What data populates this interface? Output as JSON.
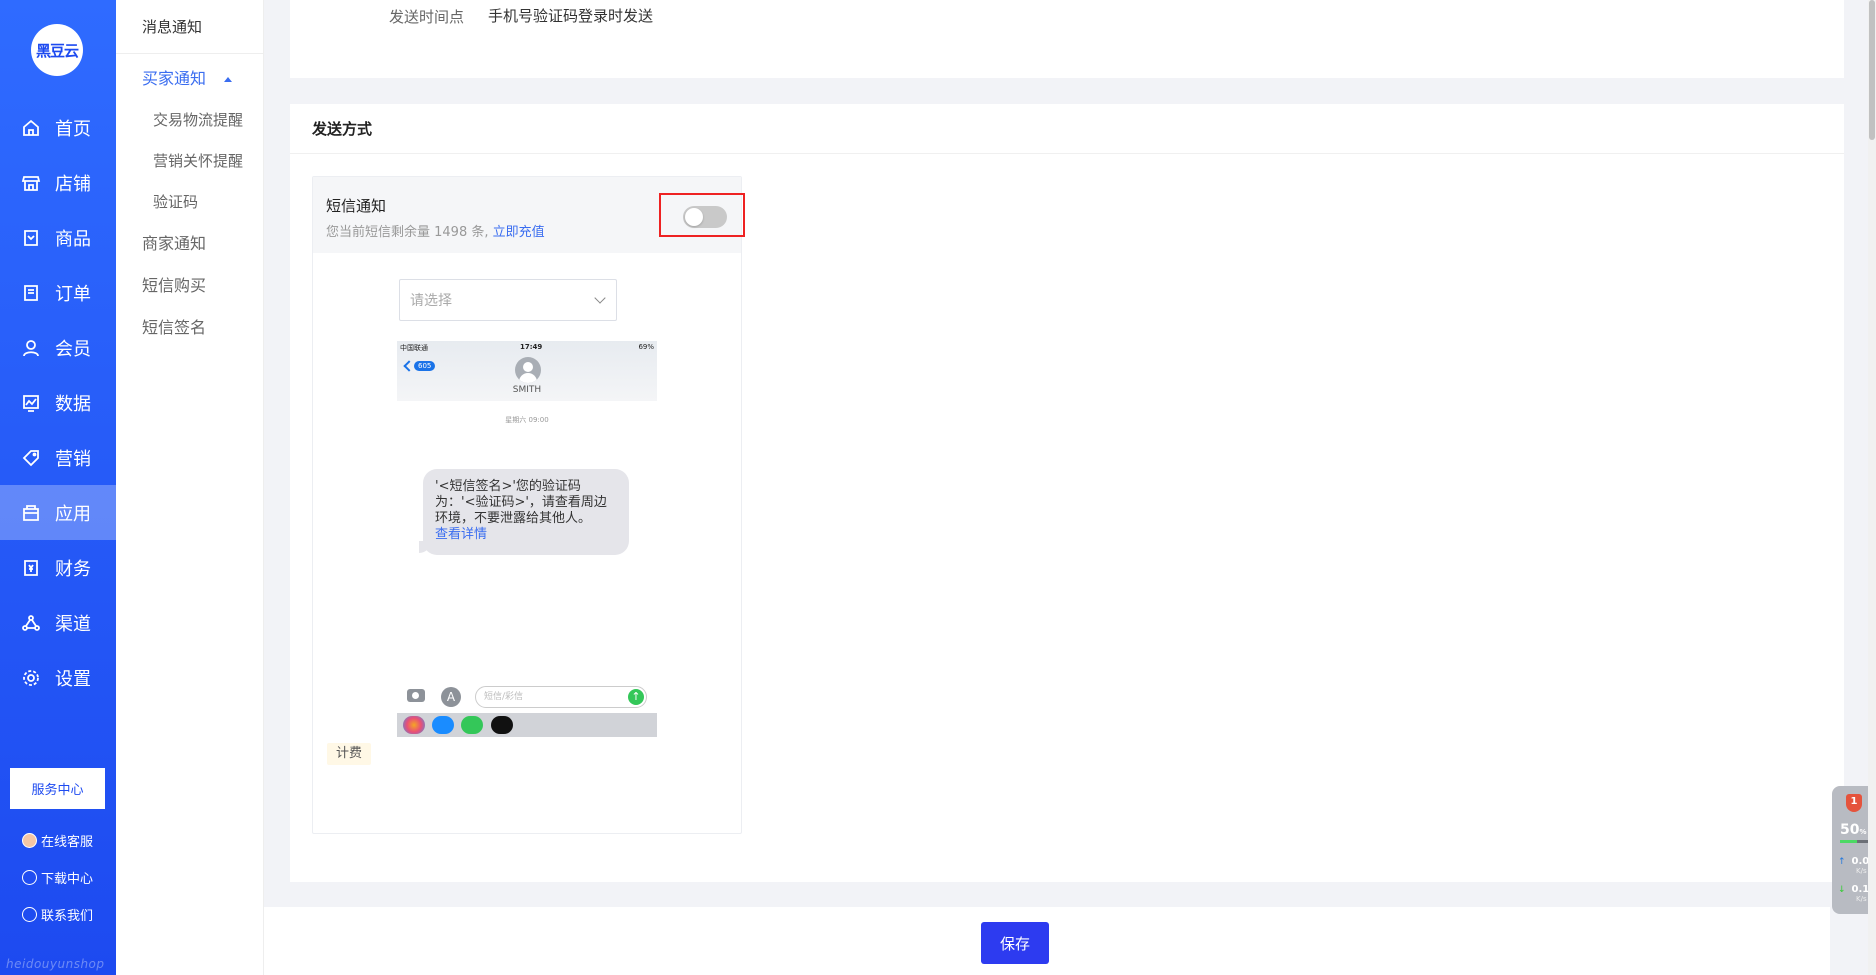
{
  "brand": {
    "logo_text": "黑豆云",
    "watermark": "heidouyunshop"
  },
  "sidebar": {
    "items": [
      {
        "label": "首页",
        "icon": "home-icon"
      },
      {
        "label": "店铺",
        "icon": "shop-icon"
      },
      {
        "label": "商品",
        "icon": "goods-icon"
      },
      {
        "label": "订单",
        "icon": "order-icon"
      },
      {
        "label": "会员",
        "icon": "member-icon"
      },
      {
        "label": "数据",
        "icon": "chart-icon"
      },
      {
        "label": "营销",
        "icon": "tag-icon"
      },
      {
        "label": "应用",
        "icon": "app-icon",
        "active": true
      },
      {
        "label": "财务",
        "icon": "finance-icon"
      },
      {
        "label": "渠道",
        "icon": "channel-icon"
      },
      {
        "label": "设置",
        "icon": "settings-icon"
      }
    ],
    "service_center": "服务中心",
    "online_service": "在线客服",
    "download_center": "下载中心",
    "contact_us": "联系我们"
  },
  "subnav": {
    "header": "消息通知",
    "buyer_notice": "买家通知",
    "buyer_children": [
      "交易物流提醒",
      "营销关怀提醒",
      "验证码"
    ],
    "merchant_notice": "商家通知",
    "sms_purchase": "短信购买",
    "sms_signature": "短信签名"
  },
  "top_card": {
    "send_time_label": "发送时间点",
    "send_time_value": "手机号验证码登录时发送"
  },
  "send_method": {
    "title": "发送方式",
    "sms": {
      "title": "短信通知",
      "desc_prefix": "您当前短信剩余量 1498 条,",
      "recharge_link": "立即充值",
      "enabled": false,
      "select_placeholder": "请选择",
      "fee_tag": "计费"
    }
  },
  "phone": {
    "carrier": "中国联通",
    "time": "17:49",
    "battery": "69%",
    "back_count": "605",
    "contact": "SMITH",
    "msg_time": "星期六 09:00",
    "bubble_text": "'<短信签名>'您的验证码为：'<验证码>'，请查看周边环境，不要泄露给其他人。",
    "bubble_link": "查看详情",
    "input_placeholder": "短信/彩信"
  },
  "footer": {
    "save_label": "保存"
  },
  "widget": {
    "badge": "1",
    "cpu": "50",
    "cpu_unit": "%",
    "up": "0.0",
    "down": "0.1",
    "unit": "K/s"
  },
  "colors": {
    "primary": "#1d4af0",
    "accent": "#3a6df0",
    "save": "#2d3bf0",
    "highlight": "#e22222"
  }
}
